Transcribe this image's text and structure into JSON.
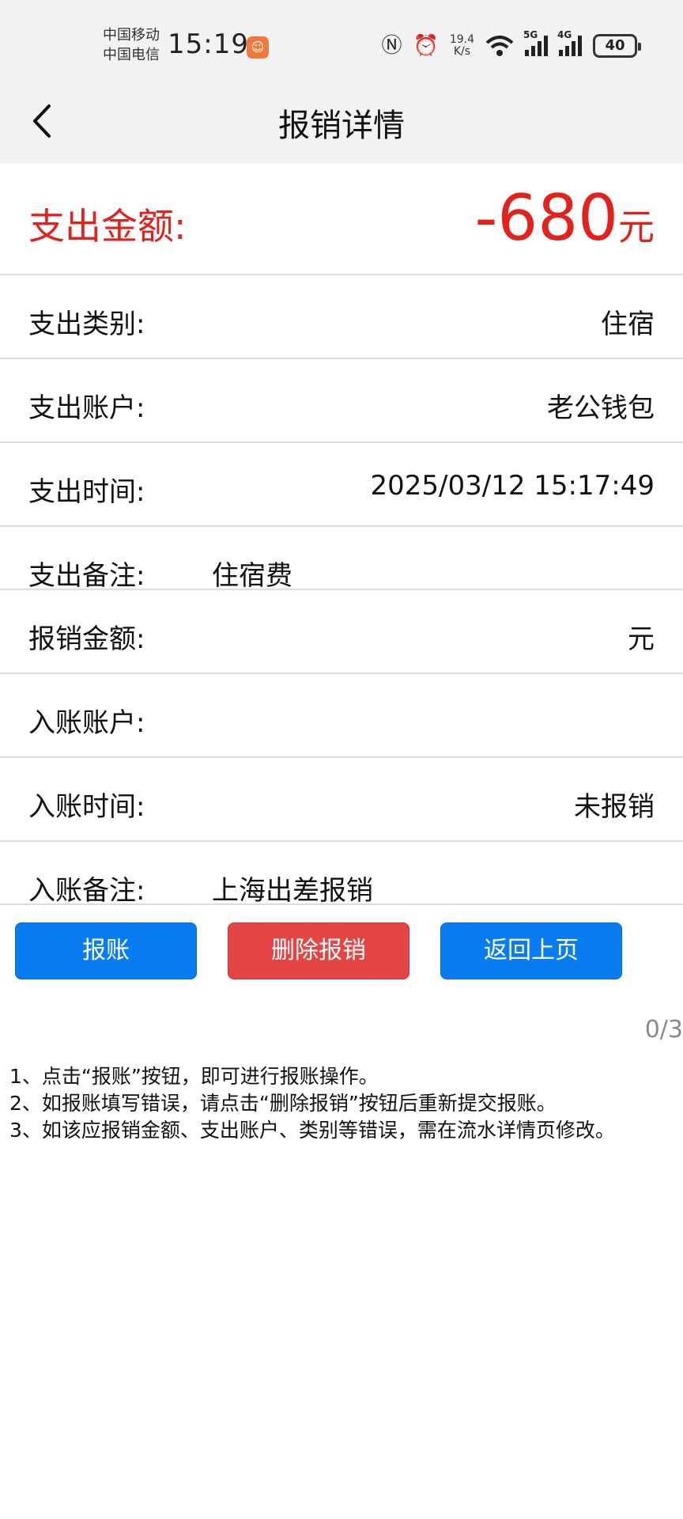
{
  "status_bar": {
    "carrier1": "中国移动",
    "carrier2": "中国电信",
    "time": "15:19",
    "net_speed_value": "19.4",
    "net_speed_unit": "K/s",
    "sig1_label": "5G",
    "sig2_label": "4G",
    "battery": "40",
    "icons": [
      "app-badge-icon",
      "nfc-icon",
      "alarm-icon",
      "wifi-icon",
      "signal-icon",
      "battery-icon"
    ]
  },
  "header": {
    "title": "报销详情",
    "back_icon": "back-chevron-icon"
  },
  "amount": {
    "label": "支出金额:",
    "value": "-680",
    "unit": "元",
    "color": "#e0231c"
  },
  "rows": [
    {
      "label": "支出类别:",
      "value": "住宿"
    },
    {
      "label": "支出账户:",
      "value": "老公钱包"
    },
    {
      "label": "支出时间:",
      "value": "2025/03/12 15:17:49"
    },
    {
      "label": "支出备注:",
      "value": "住宿费"
    },
    {
      "label": "报销金额:",
      "value": "元"
    },
    {
      "label": "入账账户:",
      "value": ""
    },
    {
      "label": "入账时间:",
      "value": "未报销"
    },
    {
      "label": "入账备注:",
      "value": "上海出差报销"
    }
  ],
  "buttons": {
    "submit": "报账",
    "delete": "删除报销",
    "back": "返回上页",
    "blue": "#0a7cf2",
    "red": "#e34545"
  },
  "pager": "0/3",
  "tips": [
    "1、点击“报账”按钮，即可进行报账操作。",
    "2、如报账填写错误，请点击“删除报销”按钮后重新提交报账。",
    "3、如该应报销金额、支出账户、类别等错误，需在流水详情页修改。"
  ]
}
